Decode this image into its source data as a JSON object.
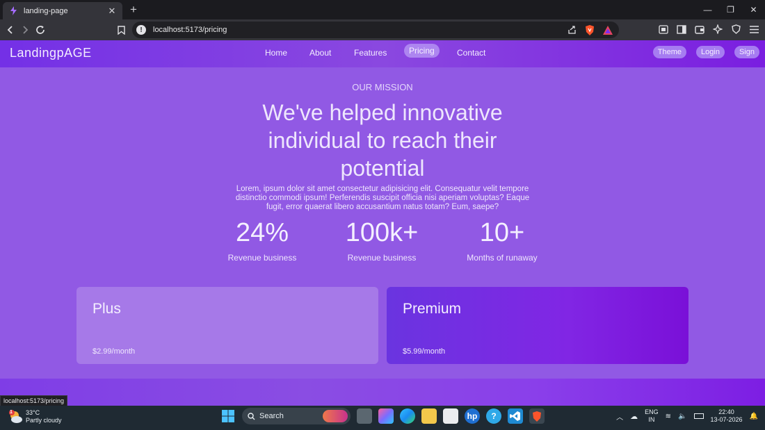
{
  "browser": {
    "tab_title": "landing-page",
    "new_tab": "+",
    "url": "localhost:5173/pricing",
    "status_url": "localhost:5173/pricing"
  },
  "navbar": {
    "brand": "LandingpAGE",
    "links": [
      {
        "label": "Home"
      },
      {
        "label": "About"
      },
      {
        "label": "Features"
      },
      {
        "label": "Pricing",
        "active": true
      },
      {
        "label": "Contact"
      }
    ],
    "actions": {
      "theme": "Theme",
      "login": "Login",
      "sign": "Sign"
    }
  },
  "mission": {
    "eyebrow": "OUR MISSION",
    "headline": "We've helped innovative individual to reach their potential",
    "body": "Lorem, ipsum dolor sit amet consectetur adipisicing elit. Consequatur velit tempore distinctio commodi ipsum! Perferendis suscipit officia nisi aperiam voluptas? Eaque fugit, error quaerat libero accusantium natus totam? Eum, saepe?",
    "stats": [
      {
        "value": "24%",
        "label": "Revenue business"
      },
      {
        "value": "100k+",
        "label": "Revenue business"
      },
      {
        "value": "10+",
        "label": "Months of runaway"
      }
    ]
  },
  "plans": [
    {
      "name": "Plus",
      "price": "$2.99/month"
    },
    {
      "name": "Premium",
      "price": "$5.99/month"
    }
  ],
  "taskbar": {
    "weather_temp": "33°C",
    "weather_desc": "Partly cloudy",
    "weather_badge": "1",
    "search_label": "Search",
    "lang_top": "ENG",
    "lang_bottom": "IN",
    "time": "22:40",
    "date": "13-07-2026"
  },
  "colors": {
    "page_bg": "#9159e4",
    "pill": "#a67cf1",
    "premium": "#7a10d8"
  }
}
